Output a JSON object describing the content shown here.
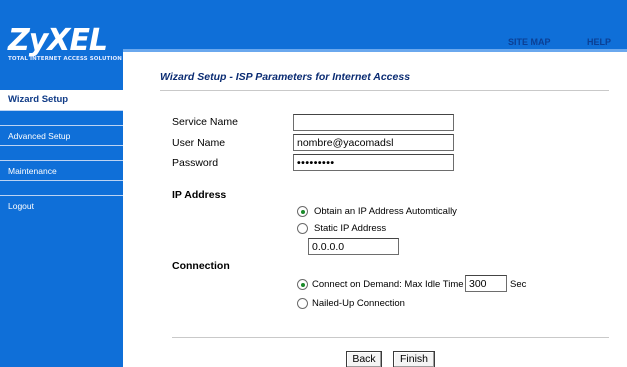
{
  "brand": {
    "logo_text": "ZyXEL",
    "tagline": "TOTAL INTERNET ACCESS SOLUTION",
    "color": "#0f6fd8"
  },
  "topbar": {
    "site_map": "SITE MAP",
    "help": "HELP"
  },
  "sidebar": {
    "items": [
      {
        "label": "Wizard Setup",
        "active": true
      },
      {
        "label": "Advanced Setup",
        "active": false
      },
      {
        "label": "Maintenance",
        "active": false
      },
      {
        "label": "Logout",
        "active": false
      }
    ]
  },
  "page": {
    "title": "Wizard Setup - ISP Parameters for Internet Access"
  },
  "form": {
    "service_name": {
      "label": "Service Name",
      "value": ""
    },
    "user_name": {
      "label": "User Name",
      "value": "nombre@yacomadsl"
    },
    "password": {
      "label": "Password",
      "value": "•••••••••"
    },
    "ip_address": {
      "heading": "IP Address",
      "options": [
        {
          "label": "Obtain an IP Address Automtically",
          "checked": true
        },
        {
          "label": "Static IP Address",
          "checked": false
        }
      ],
      "static_value": "0.0.0.0"
    },
    "connection": {
      "heading": "Connection",
      "on_demand_label": "Connect on Demand: Max Idle Time",
      "idle_time": "300",
      "idle_unit": "Sec",
      "nailed_up_label": "Nailed-Up Connection",
      "on_demand_checked": true
    }
  },
  "buttons": {
    "back": "Back",
    "finish": "Finish"
  }
}
